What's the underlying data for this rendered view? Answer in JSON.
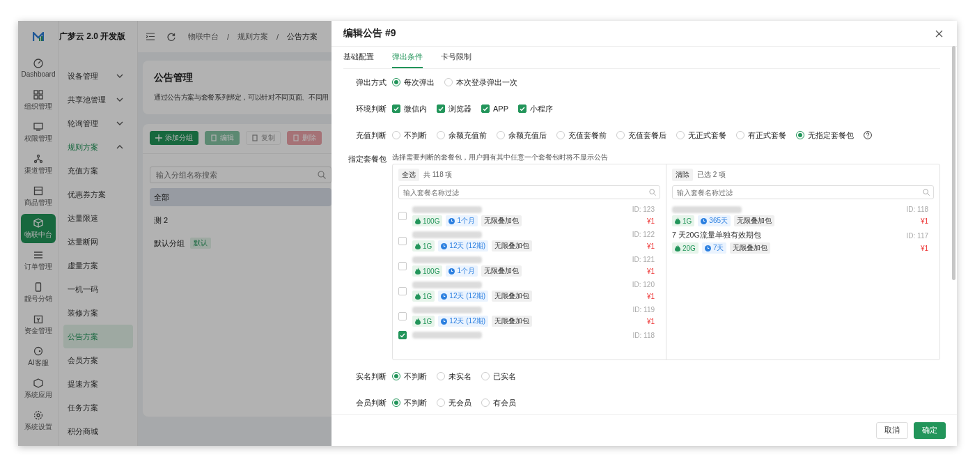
{
  "app": {
    "logo_text": "广梦云 2.0 开发版"
  },
  "rail": [
    {
      "label": "Dashboard",
      "selected": false
    },
    {
      "label": "组织管理",
      "selected": false
    },
    {
      "label": "权限管理",
      "selected": false
    },
    {
      "label": "渠道管理",
      "selected": false
    },
    {
      "label": "商品管理",
      "selected": false
    },
    {
      "label": "物联中台",
      "selected": true
    },
    {
      "label": "订单管理",
      "selected": false
    },
    {
      "label": "靓号分销",
      "selected": false
    },
    {
      "label": "资金管理",
      "selected": false
    },
    {
      "label": "AI客服",
      "selected": false
    },
    {
      "label": "系统应用",
      "selected": false
    },
    {
      "label": "系统设置",
      "selected": false
    }
  ],
  "submenu": [
    {
      "label": "设备管理",
      "kind": "group",
      "expanded": false,
      "selected": false
    },
    {
      "label": "共享池管理",
      "kind": "group",
      "expanded": false,
      "selected": false
    },
    {
      "label": "轮询管理",
      "kind": "group",
      "expanded": false,
      "selected": false
    },
    {
      "label": "规则方案",
      "kind": "group",
      "expanded": true,
      "selected": true
    },
    {
      "label": "充值方案",
      "kind": "item",
      "selected": false
    },
    {
      "label": "优惠券方案",
      "kind": "item",
      "selected": false
    },
    {
      "label": "达量限速",
      "kind": "item",
      "selected": false
    },
    {
      "label": "达量断网",
      "kind": "item",
      "selected": false
    },
    {
      "label": "虚量方案",
      "kind": "item",
      "selected": false
    },
    {
      "label": "一机一码",
      "kind": "item",
      "selected": false
    },
    {
      "label": "装修方案",
      "kind": "item",
      "selected": false
    },
    {
      "label": "公告方案",
      "kind": "item",
      "selected": true
    },
    {
      "label": "会员方案",
      "kind": "item",
      "selected": false
    },
    {
      "label": "提速方案",
      "kind": "item",
      "selected": false
    },
    {
      "label": "任务方案",
      "kind": "item",
      "selected": false
    },
    {
      "label": "积分商城",
      "kind": "item",
      "selected": false
    }
  ],
  "breadcrumb": [
    {
      "label": "物联中台"
    },
    {
      "separator": "/",
      "label": "规则方案"
    },
    {
      "separator": "/",
      "label": "公告方案"
    }
  ],
  "page": {
    "title": "公告管理",
    "description": "通过公告方案与套餐系列绑定，可以针对不同页面、不同用"
  },
  "toolbar": [
    {
      "label": "添加分组",
      "kind": "add",
      "disabled": false
    },
    {
      "label": "编辑",
      "kind": "edit",
      "disabled": true
    },
    {
      "label": "复制",
      "kind": "copy",
      "disabled": true
    },
    {
      "label": "删除",
      "kind": "delete",
      "disabled": true
    }
  ],
  "group_search": {
    "placeholder": "输入分组名称搜索"
  },
  "groups": [
    {
      "label": "全部",
      "selected": true
    },
    {
      "label": "测 2",
      "selected": false
    },
    {
      "label": "默认分组",
      "badge": "默认",
      "selected": false
    }
  ],
  "drawer": {
    "title": "编辑公告 #9",
    "tabs": [
      {
        "label": "基础配置",
        "selected": false
      },
      {
        "label": "弹出条件",
        "selected": true
      },
      {
        "label": "卡号限制",
        "selected": false
      }
    ],
    "rows": [
      {
        "label": "弹出方式",
        "kind": "radio",
        "options": [
          {
            "label": "每次弹出",
            "selected": true
          },
          {
            "label": "本次登录弹出一次",
            "selected": false
          }
        ]
      },
      {
        "label": "环境判断",
        "kind": "checkbox",
        "options": [
          {
            "label": "微信内",
            "checked": true
          },
          {
            "label": "浏览器",
            "checked": true
          },
          {
            "label": "APP",
            "checked": true
          },
          {
            "label": "小程序",
            "checked": true
          }
        ]
      },
      {
        "label": "充值判断",
        "kind": "radio",
        "help": true,
        "options": [
          {
            "label": "不判断",
            "selected": false
          },
          {
            "label": "余额充值前",
            "selected": false
          },
          {
            "label": "余额充值后",
            "selected": false
          },
          {
            "label": "充值套餐前",
            "selected": false
          },
          {
            "label": "充值套餐后",
            "selected": false
          },
          {
            "label": "无正式套餐",
            "selected": false
          },
          {
            "label": "有正式套餐",
            "selected": false
          },
          {
            "label": "无指定套餐包",
            "selected": true
          }
        ]
      },
      {
        "label": "指定套餐包",
        "kind": "transfer",
        "hint": "选择需要判断的套餐包，用户拥有其中任意一个套餐包时将不显示公告",
        "panels": [
          {
            "action": "全选",
            "count": "共 118 项",
            "placeholder": "输入套餐名称过滤",
            "items": [
              {
                "checked": false,
                "id_label": "ID: 123",
                "price": "¥1",
                "tags": [
                  {
                    "kind": "data",
                    "label": "100G"
                  },
                  {
                    "kind": "period",
                    "label": "1个月"
                  },
                  {
                    "kind": "plain",
                    "label": "无限叠加包"
                  }
                ]
              },
              {
                "checked": false,
                "id_label": "ID: 122",
                "price": "¥1",
                "tags": [
                  {
                    "kind": "data",
                    "label": "1G"
                  },
                  {
                    "kind": "period",
                    "label": "12天 (12期)"
                  },
                  {
                    "kind": "plain",
                    "label": "无限叠加包"
                  }
                ]
              },
              {
                "checked": false,
                "id_label": "ID: 121",
                "price": "¥1",
                "tags": [
                  {
                    "kind": "data",
                    "label": "100G"
                  },
                  {
                    "kind": "period",
                    "label": "1个月"
                  },
                  {
                    "kind": "plain",
                    "label": "无限叠加包"
                  }
                ]
              },
              {
                "checked": false,
                "id_label": "ID: 120",
                "price": "¥1",
                "tags": [
                  {
                    "kind": "data",
                    "label": "1G"
                  },
                  {
                    "kind": "period",
                    "label": "12天 (12期)"
                  },
                  {
                    "kind": "plain",
                    "label": "无限叠加包"
                  }
                ]
              },
              {
                "checked": false,
                "id_label": "ID: 119",
                "price": "¥1",
                "tags": [
                  {
                    "kind": "data",
                    "label": "1G"
                  },
                  {
                    "kind": "period",
                    "label": "12天 (12期)"
                  },
                  {
                    "kind": "plain",
                    "label": "无限叠加包"
                  }
                ]
              },
              {
                "checked": true,
                "id_label": "ID: 118"
              }
            ]
          },
          {
            "action": "清除",
            "count": "已选 2 项",
            "placeholder": "输入套餐名称过滤",
            "items": [
              {
                "id_label": "ID: 118",
                "price": "¥1",
                "tags": [
                  {
                    "kind": "data",
                    "label": "1G"
                  },
                  {
                    "kind": "period",
                    "label": "365天"
                  },
                  {
                    "kind": "plain",
                    "label": "无限叠加包"
                  }
                ]
              },
              {
                "name": "7 天20G流量单独有效期包",
                "id_label": "ID: 117",
                "price": "¥1",
                "tags": [
                  {
                    "kind": "data",
                    "label": "20G"
                  },
                  {
                    "kind": "period",
                    "label": "7天"
                  },
                  {
                    "kind": "plain",
                    "label": "无限叠加包"
                  }
                ]
              }
            ]
          }
        ]
      },
      {
        "label": "实名判断",
        "kind": "radio",
        "options": [
          {
            "label": "不判断",
            "selected": true
          },
          {
            "label": "未实名",
            "selected": false
          },
          {
            "label": "已实名",
            "selected": false
          }
        ]
      },
      {
        "label": "会员判断",
        "kind": "radio",
        "options": [
          {
            "label": "不判断",
            "selected": true
          },
          {
            "label": "无会员",
            "selected": false
          },
          {
            "label": "有会员",
            "selected": false
          }
        ]
      }
    ],
    "buttons": [
      {
        "label": "取消",
        "kind": "default"
      },
      {
        "label": "确定",
        "kind": "primary"
      }
    ]
  }
}
